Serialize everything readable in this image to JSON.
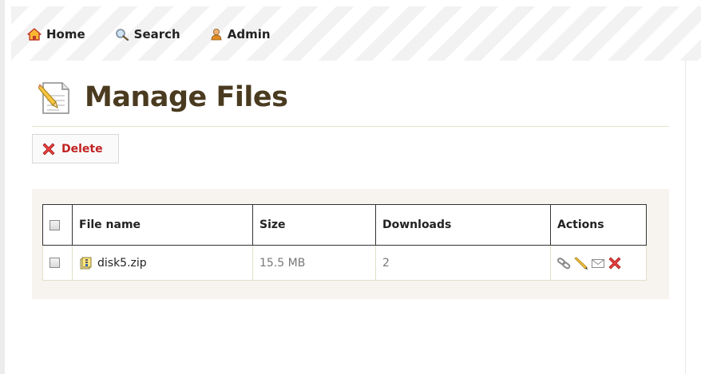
{
  "nav": {
    "home_label": "Home",
    "search_label": "Search",
    "admin_label": "Admin"
  },
  "page_title": "Manage Files",
  "toolbar": {
    "delete_label": "Delete"
  },
  "table": {
    "headers": {
      "file_name": "File name",
      "size": "Size",
      "downloads": "Downloads",
      "actions": "Actions"
    },
    "rows": [
      {
        "file_name": "disk5.zip",
        "file_icon": "zip-file-icon",
        "size": "15.5 MB",
        "downloads": "2",
        "actions": [
          "link-icon",
          "edit-pencil-icon",
          "email-icon",
          "delete-x-icon"
        ]
      }
    ]
  },
  "colors": {
    "title_brown": "#4a3b20",
    "delete_red": "#c12222",
    "panel_bg": "#f7f4ef"
  }
}
